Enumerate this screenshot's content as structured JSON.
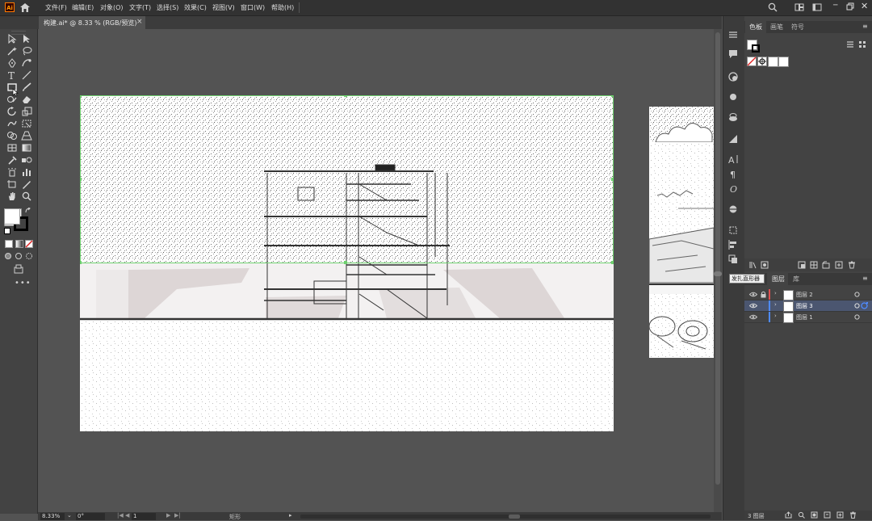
{
  "app": {
    "logo_text": "Ai",
    "brand_color": "#ff7c00"
  },
  "menu": {
    "items": [
      "文件(F)",
      "编辑(E)",
      "对象(O)",
      "文字(T)",
      "选择(S)",
      "效果(C)",
      "视图(V)",
      "窗口(W)",
      "帮助(H)"
    ]
  },
  "document": {
    "tab_title": "构建.ai* @ 8.33 % (RGB/预览)",
    "close_glyph": "×"
  },
  "status": {
    "zoom": "8.33%",
    "rotation": "0°",
    "artboard": "1",
    "mode": "矩形"
  },
  "panels": {
    "swatch_tabs": [
      "色板",
      "画笔",
      "符号"
    ],
    "layers_tabs": [
      "图层",
      "库"
    ],
    "tooltip": "发扎直形器",
    "layers": [
      {
        "name": "图层 2",
        "color": "#e05050",
        "locked": true,
        "selected": false
      },
      {
        "name": "图层 3",
        "color": "#4f8bff",
        "locked": false,
        "selected": true
      },
      {
        "name": "图层 1",
        "color": "#4f8bff",
        "locked": false,
        "selected": false
      }
    ],
    "layer_count": "3 图层"
  },
  "colors": {
    "selection_green": "#6ed06e",
    "selected_layer_bg": "#4b5670"
  }
}
